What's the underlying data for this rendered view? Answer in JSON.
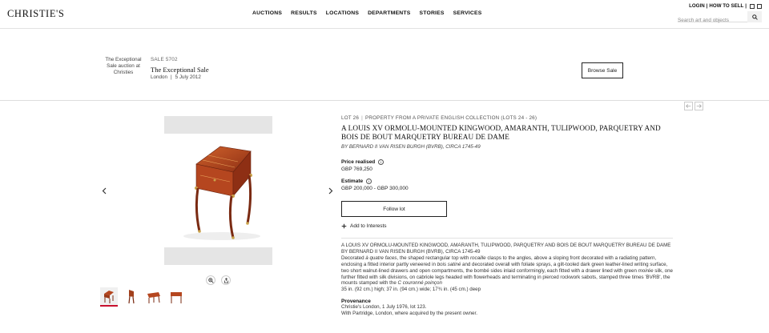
{
  "header": {
    "logo": "CHRISTIE'S",
    "nav": [
      "AUCTIONS",
      "RESULTS",
      "LOCATIONS",
      "DEPARTMENTS",
      "STORIES",
      "SERVICES"
    ],
    "login": "LOGIN",
    "separator": "|",
    "how_to_sell": "HOW TO SELL",
    "search_placeholder": "Search art and objects"
  },
  "sale": {
    "image_alt": "The Exceptional Sale auction at Christies",
    "number": "SALE 5702",
    "title": "The Exceptional Sale",
    "location": "London",
    "separator": "|",
    "date": "5 July 2012",
    "browse_label": "Browse Sale"
  },
  "lot": {
    "number": "LOT 26",
    "separator": "|",
    "collection": "PROPERTY FROM A PRIVATE ENGLISH COLLECTION (LOTS 24 - 26)",
    "title": "A LOUIS XV ORMOLU-MOUNTED KINGWOOD, AMARANTH, TULIPWOOD, PARQUETRY AND BOIS DE BOUT MARQUETRY BUREAU DE DAME",
    "maker": "BY BERNARD II VAN RISEN BURGH (BVRB), CIRCA 1745-49",
    "price_label": "Price realised",
    "price_value": "GBP 769,250",
    "estimate_label": "Estimate",
    "estimate_value": "GBP 200,000 - GBP 300,000",
    "follow_label": "Follow lot",
    "interests_label": "Add to Interests",
    "info_glyph": "i"
  },
  "description": {
    "title": "A LOUIS XV ORMOLU-MOUNTED KINGWOOD, AMARANTH, TULIPWOOD, PARQUETRY AND BOIS DE BOUT MARQUETRY BUREAU DE DAME",
    "maker": "BY BERNARD II VAN RISEN BURGH (BVRB), CIRCA 1745-49",
    "p1_a": "Decorated ",
    "p1_i1": "à quatre faces",
    "p1_b": ", the shaped rectangular top with ",
    "p1_i2": "rocaille",
    "p1_c": " clasps to the angles, above a sloping front decorated with a radiating pattern, enclosing a fitted interior partly veneered in ",
    "p1_i3": "bois satiné",
    "p1_d": " and decorated overall with foliate sprays, a gilt-tooled dark green leather-lined writing surface, two short walnut-lined drawers and open compartments, the bombé sides inlaid conformingly, each fitted with a drawer lined with green ",
    "p1_i4": "moirée",
    "p1_e": " silk, one further fitted with silk divisions, on cabriole legs headed with flowerheads and terminating in pierced rockwork sabots, stamped three times 'BVRB', the mounts stamped with the ",
    "p1_i5": "C couronné poinçon",
    "dimensions": "35 in. (92 cm.) high; 37 in. (94 cm.) wide; 17¾ in. (45 cm.) deep"
  },
  "provenance": {
    "label": "Provenance",
    "line1": "Christie's London, 1 July 1976, lot 123.",
    "line2": "With Partridge, London, where acquired by the present owner."
  },
  "icons": {
    "search": "search-icon",
    "prev": "chevron-left-icon",
    "next": "chevron-right-icon",
    "zoom": "zoom-icon",
    "share": "share-icon",
    "plus": "plus-icon",
    "info": "info-icon"
  },
  "colors": {
    "accent": "#c8102e",
    "wood": "#b5461f",
    "gilt": "#c9a24a"
  }
}
